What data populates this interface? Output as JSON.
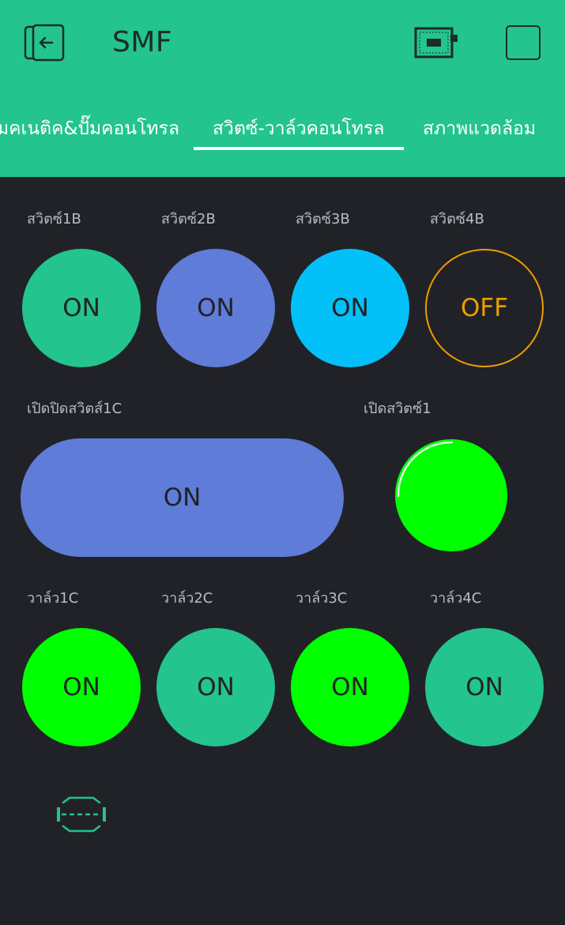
{
  "header": {
    "title": "SMF",
    "tabs": [
      {
        "label": "มคเนติค&ปั๊มคอนโทรล"
      },
      {
        "label": "สวิตซ์-วาล์วคอนโทรล"
      },
      {
        "label": "สภาพแวดล้อม"
      }
    ],
    "active_tab": 1,
    "icons": [
      "exit-icon",
      "device-icon",
      "square-icon"
    ]
  },
  "switches_b": [
    {
      "label": "สวิตซ์1B",
      "state": "ON"
    },
    {
      "label": "สวิตซ์2B",
      "state": "ON"
    },
    {
      "label": "สวิตซ์3B",
      "state": "ON"
    },
    {
      "label": "สวิตซ์4B",
      "state": "OFF"
    }
  ],
  "switch_1c": {
    "label": "เปิดปิดสวิตส์1C",
    "state": "ON"
  },
  "led_1": {
    "label": "เปิดสวิตซ์1"
  },
  "valves": [
    {
      "label": "วาล์ว1C",
      "state": "ON"
    },
    {
      "label": "วาล์ว2C",
      "state": "ON"
    },
    {
      "label": "วาล์ว3C",
      "state": "ON"
    },
    {
      "label": "วาล์ว4C",
      "state": "ON"
    }
  ],
  "colors": {
    "accent_green": "#23c48e",
    "purple": "#5f7cd8",
    "cyan": "#04c0f8",
    "orange": "#ed9d00",
    "bright_green": "#00ff00",
    "background": "#212227"
  }
}
